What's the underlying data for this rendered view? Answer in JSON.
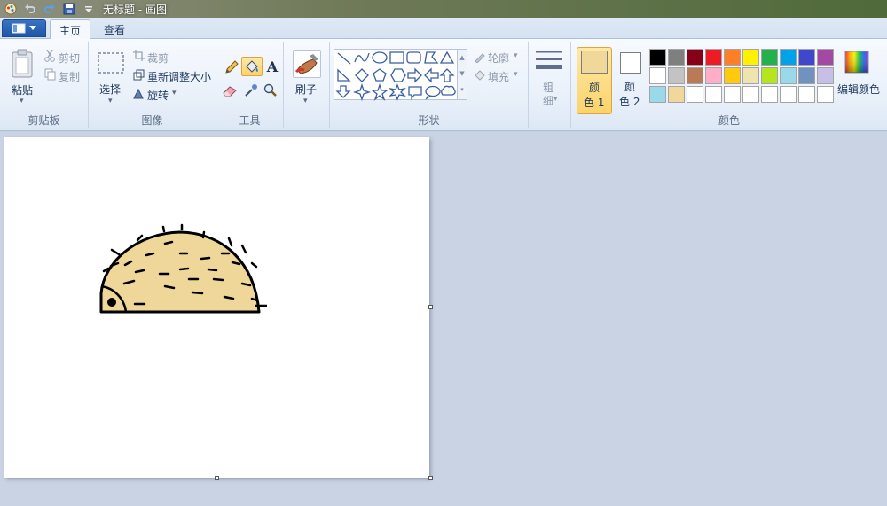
{
  "window": {
    "title": "无标题 - 画图"
  },
  "tabs": [
    {
      "label": "主页",
      "active": true
    },
    {
      "label": "查看",
      "active": false
    }
  ],
  "ribbon": {
    "clipboard": {
      "label": "剪贴板",
      "paste": "粘贴",
      "cut": "剪切",
      "copy": "复制"
    },
    "image": {
      "label": "图像",
      "select": "选择",
      "crop": "裁剪",
      "resize": "重新调整大小",
      "rotate": "旋转"
    },
    "tools": {
      "label": "工具"
    },
    "brushes": {
      "label": "刷子"
    },
    "shapes": {
      "label": "形状",
      "outline": "轮廓",
      "fill": "填充"
    },
    "size": {
      "label_line1": "粗",
      "label_line2": "细"
    },
    "colors": {
      "label": "颜色",
      "color1_line1": "颜",
      "color1_line2": "色 1",
      "color2_line1": "颜",
      "color2_line2": "色 2",
      "edit_colors": "编辑颜色",
      "color1_value": "#efd89a",
      "color2_value": "#ffffff",
      "palette_row1": [
        "#000000",
        "#7f7f7f",
        "#880015",
        "#ed1c24",
        "#ff7f27",
        "#fff200",
        "#22b14c",
        "#00a2e8",
        "#3f48cc",
        "#a349a4"
      ],
      "palette_row2": [
        "#ffffff",
        "#c3c3c3",
        "#b97a57",
        "#ffaec9",
        "#ffc90e",
        "#efe4b0",
        "#b5e61d",
        "#99d9ea",
        "#7092be",
        "#c8bfe7"
      ],
      "palette_row3": [
        "#99d9ea",
        "#efd89a",
        "#ffffff",
        "#ffffff",
        "#ffffff",
        "#ffffff",
        "#ffffff",
        "#ffffff",
        "#ffffff",
        "#ffffff"
      ]
    }
  }
}
